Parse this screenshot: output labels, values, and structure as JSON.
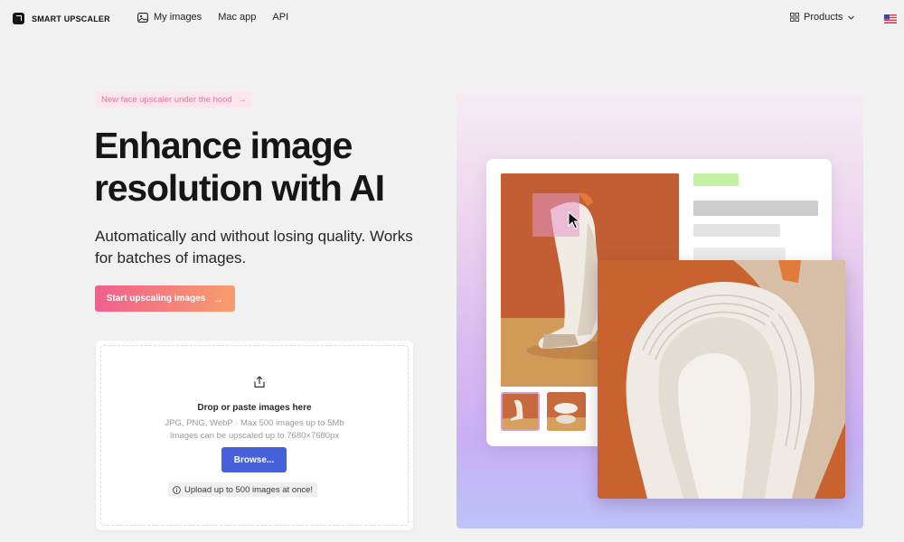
{
  "brand": {
    "name": "SMART UPSCALER"
  },
  "nav": {
    "items": [
      {
        "label": "My images",
        "icon": "images-icon"
      },
      {
        "label": "Mac app"
      },
      {
        "label": "API"
      }
    ],
    "products_label": "Products",
    "locale_icon": "us-flag-icon"
  },
  "hero": {
    "badge": "New face upscaler under the hood",
    "headline": "Enhance image resolution with AI",
    "subline": "Automatically and without losing quality. Works for batches of images.",
    "cta": "Start upscaling images"
  },
  "upload": {
    "title": "Drop or paste images here",
    "hint_formats": "JPG, PNG, WebP · Max 500 images up to 5Mb",
    "hint_size": "Images can be upscaled up to 7680×7680px",
    "browse_label": "Browse...",
    "limit_note": "Upload up to 500 images at once!"
  },
  "colors": {
    "accent_blue": "#4560d9",
    "cta_start": "#f25f8e",
    "cta_end": "#f89d6b",
    "badge_text": "#e8739e",
    "photo_orange": "#c8622f"
  }
}
